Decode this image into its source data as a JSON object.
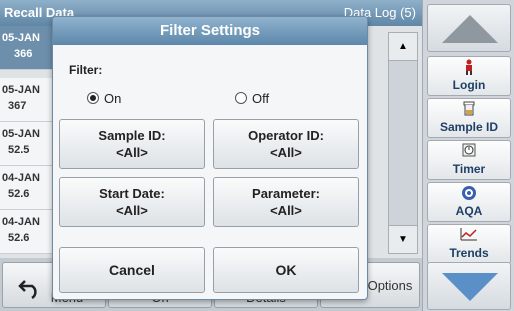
{
  "background": {
    "header_title": "Recall Data",
    "header_right": "Data Log (5)",
    "rows": [
      {
        "date": "05-JAN",
        "value": "366"
      },
      {
        "date": "05-JAN",
        "value": "367"
      },
      {
        "date": "05-JAN",
        "value": "52.5"
      },
      {
        "date": "04-JAN",
        "value": "52.6"
      },
      {
        "date": "04-JAN",
        "value": "52.6"
      }
    ],
    "bottom_buttons": [
      "Menu",
      "On",
      "Details",
      "Options"
    ]
  },
  "sidebar": {
    "items": [
      {
        "label": "Login",
        "icon": "person-icon"
      },
      {
        "label": "Sample ID",
        "icon": "beaker-icon"
      },
      {
        "label": "Timer",
        "icon": "timer-icon"
      },
      {
        "label": "AQA",
        "icon": "aqa-icon"
      },
      {
        "label": "Trends",
        "icon": "trends-icon"
      }
    ]
  },
  "dialog": {
    "title": "Filter Settings",
    "filter_label": "Filter:",
    "radio_on": "On",
    "radio_off": "Off",
    "selected": "On",
    "sample_id_label": "Sample ID:",
    "sample_id_value": "<All>",
    "operator_id_label": "Operator ID:",
    "operator_id_value": "<All>",
    "start_date_label": "Start Date:",
    "start_date_value": "<All>",
    "parameter_label": "Parameter:",
    "parameter_value": "<All>",
    "cancel": "Cancel",
    "ok": "OK"
  },
  "colors": {
    "title_bar": "#5d87aa",
    "accent_text": "#1f3f66"
  }
}
